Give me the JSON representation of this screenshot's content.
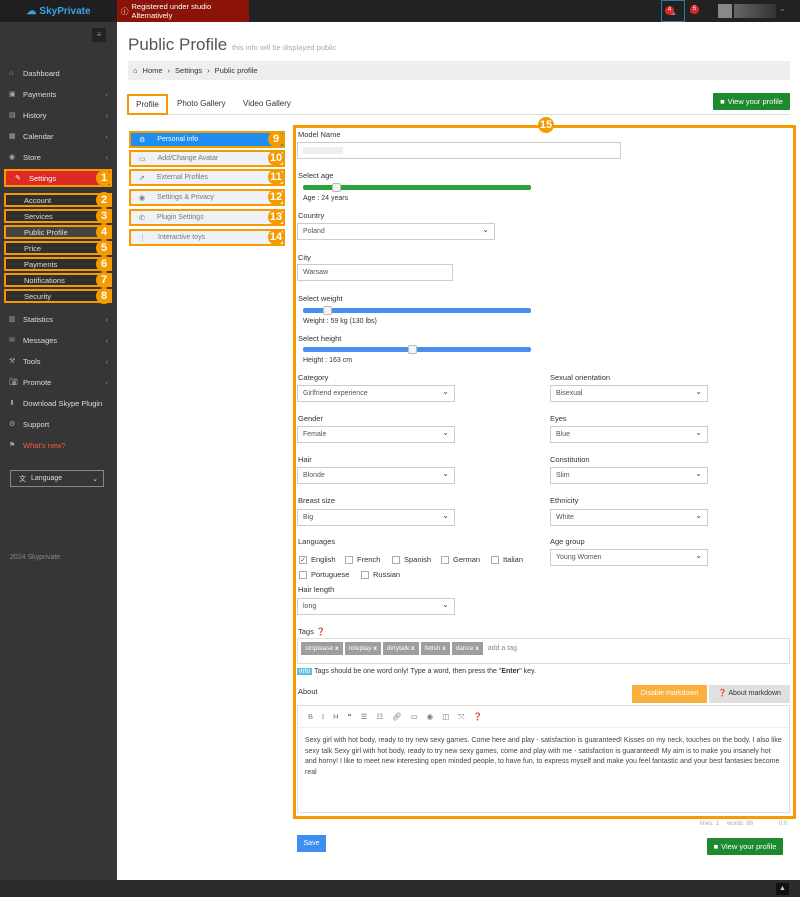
{
  "header": {
    "logo": "SkyPrivate",
    "alert": "Registered under studio Alternatively",
    "notif_count": "4",
    "msg_count": "5"
  },
  "sidebar": {
    "items": [
      {
        "label": "Dashboard",
        "icon": "home-icon"
      },
      {
        "label": "Payments",
        "icon": "money-icon"
      },
      {
        "label": "History",
        "icon": "book-icon"
      },
      {
        "label": "Calendar",
        "icon": "calendar-icon"
      },
      {
        "label": "Store",
        "icon": "store-icon"
      },
      {
        "label": "Settings",
        "icon": "wrench-icon"
      }
    ],
    "settings_sub": [
      "Account",
      "Services",
      "Public Profile",
      "Price",
      "Payments",
      "Notifications",
      "Security"
    ],
    "items2": [
      {
        "label": "Statistics"
      },
      {
        "label": "Messages"
      },
      {
        "label": "Tools"
      },
      {
        "label": "Promote"
      },
      {
        "label": "Download Skype Plugin"
      },
      {
        "label": "Support"
      },
      {
        "label": "What's new?"
      }
    ],
    "language": "Language",
    "footer": "2024 Skyprivate"
  },
  "annotations": [
    "1",
    "2",
    "3",
    "4",
    "5",
    "6",
    "7",
    "8",
    "9",
    "10",
    "11",
    "12",
    "13",
    "14",
    "15"
  ],
  "page": {
    "title": "Public Profile",
    "subtitle": "this info will be displayed public",
    "breadcrumb": [
      "Home",
      "Settings",
      "Public profile"
    ],
    "tabs": [
      "Profile",
      "Photo Gallery",
      "Video Gallery"
    ],
    "view_profile": "View your profile"
  },
  "submenu": [
    "Personal info",
    "Add/Change Avatar",
    "External Profiles",
    "Settings & Privacy",
    "Plugin Settings",
    "Interactive toys"
  ],
  "form": {
    "model_name_label": "Model Name",
    "age_label": "Select age",
    "age_text": "Age : 24 years",
    "age_value": 24,
    "country_label": "Country",
    "country": "Poland",
    "city_label": "City",
    "city": "Warsaw",
    "weight_label": "Select weight",
    "weight_text": "Weight : 59 kg (130 lbs)",
    "weight_value": 59,
    "height_label": "Select height",
    "height_text": "Height : 163 cm",
    "height_value": 163,
    "category_label": "Category",
    "category": "Girlfriend experience",
    "orientation_label": "Sexual orientation",
    "orientation": "Bisexual",
    "gender_label": "Gender",
    "gender": "Female",
    "eyes_label": "Eyes",
    "eyes": "Blue",
    "hair_label": "Hair",
    "hair": "Blonde",
    "constitution_label": "Constitution",
    "constitution": "Slim",
    "breast_label": "Breast size",
    "breast": "Big",
    "ethnicity_label": "Ethnicity",
    "ethnicity": "White",
    "languages_label": "Languages",
    "languages": [
      {
        "name": "English",
        "checked": true
      },
      {
        "name": "French",
        "checked": false
      },
      {
        "name": "Spanish",
        "checked": false
      },
      {
        "name": "German",
        "checked": false
      },
      {
        "name": "Italian",
        "checked": false
      },
      {
        "name": "Portuguese",
        "checked": false
      },
      {
        "name": "Russian",
        "checked": false
      }
    ],
    "agegroup_label": "Age group",
    "agegroup": "Young Women",
    "hairlength_label": "Hair length",
    "hairlength": "long",
    "tags_label": "Tags",
    "tags": [
      "striptease",
      "roleplay",
      "dirtytalk",
      "fetish",
      "dance"
    ],
    "tag_placeholder": "add a tag",
    "info_badge": "info",
    "tags_hint_a": "Tags should be one word only! Type a word, then press the \"",
    "tags_hint_b": "Enter",
    "tags_hint_c": "\" key.",
    "about_label": "About",
    "disable_markdown": "Disable markdown",
    "about_markdown": "About markdown",
    "about_text": "Sexy girl with hot body, ready to try new sexy games. Come here and play - satisfaction is guaranteed! Kisses on my neck, touches on the body. I also like sexy talk Sexy girl with hot body, ready to try new sexy games, come and play with me - satisfaction is guaranteed! My aim is to make you insanely hot and horny! I like to meet new interesting open minded people, to have fun, to express myself and make you feel fantastic and your best fantasies become real",
    "status_lines": "lines: 1",
    "status_words": "words: 86",
    "status_cursor": "0:0",
    "save": "Save"
  },
  "colors": {
    "accent": "#f59b00",
    "settings_red": "#dd2a25",
    "blue": "#2196f3",
    "green": "#1e8a2f"
  }
}
